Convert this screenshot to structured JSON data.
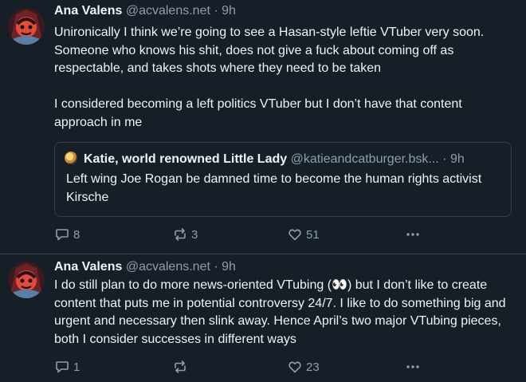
{
  "posts": [
    {
      "author_name": "Ana Valens",
      "handle": "@acvalens.net",
      "separator": "·",
      "time": "9h",
      "text_paragraphs": [
        "Unironically I think we’re going to see a Hasan-style leftie VTuber very soon. Someone who knows his shit, does not give a fuck about coming off as respectable, and takes shots where they need to be taken",
        "I considered becoming a left politics VTuber but I don’t have that content approach in me"
      ],
      "quote": {
        "author_name": "Katie, world renowned Little Lady",
        "handle": "@katieandcatburger.bsk...",
        "separator": "·",
        "time": "9h",
        "text": "Left wing Joe Rogan be damned time to become the human rights activist Kirsche"
      },
      "actions": {
        "replies": "8",
        "reposts": "3",
        "likes": "51"
      }
    },
    {
      "author_name": "Ana Valens",
      "handle": "@acvalens.net",
      "separator": "·",
      "time": "9h",
      "text": "I do still plan to do more news-oriented VTubing (👀) but I don’t like to create content that puts me in potential controversy 24/7. I like to do something big and urgent and necessary then slink away. Hence April’s two major VTubing pieces, both I consider successes in different ways",
      "actions": {
        "replies": "1",
        "reposts": "",
        "likes": "23"
      }
    }
  ],
  "icons": [
    "avatar-image",
    "reply-icon",
    "repost-icon",
    "like-icon",
    "more-icon"
  ],
  "colors": {
    "background": "#161e27",
    "text": "#f1f3f5",
    "muted": "#8d9eb2",
    "border": "#2e4052"
  }
}
